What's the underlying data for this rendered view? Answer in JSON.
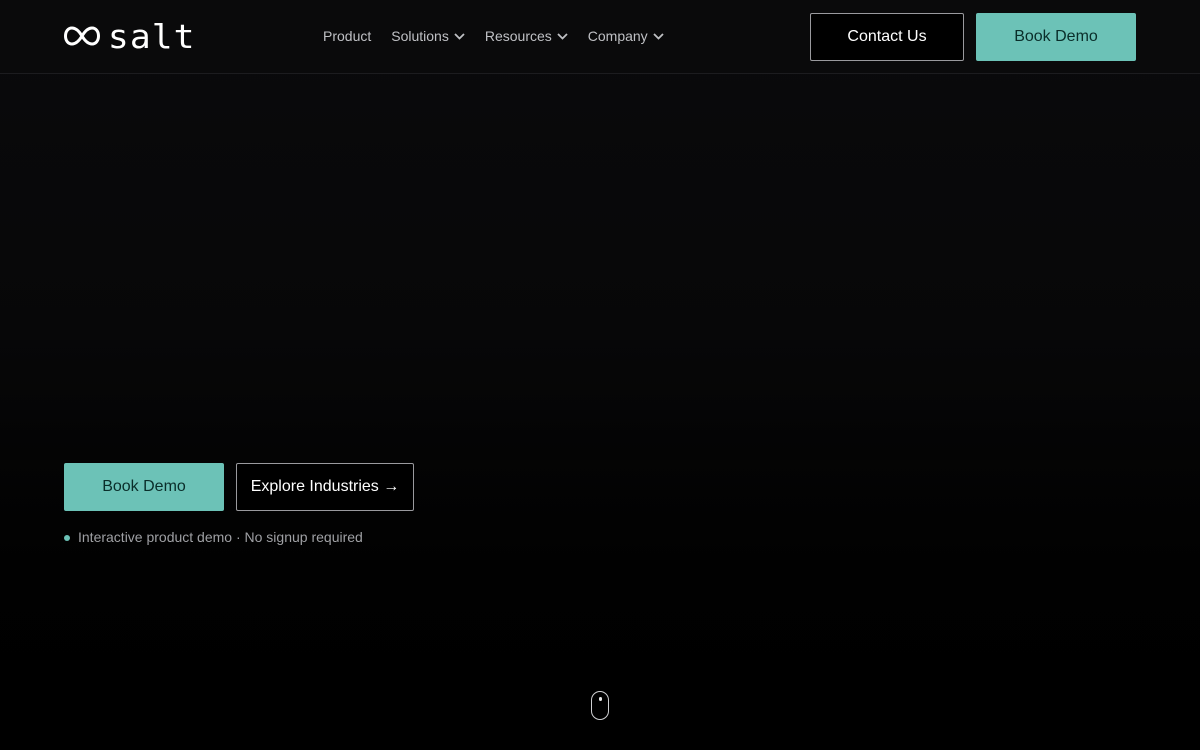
{
  "brand": {
    "name": "salt",
    "icon": "infinity-logo-icon"
  },
  "nav": {
    "items": [
      {
        "label": "Product",
        "has_dropdown": false
      },
      {
        "label": "Solutions",
        "has_dropdown": true
      },
      {
        "label": "Resources",
        "has_dropdown": true
      },
      {
        "label": "Company",
        "has_dropdown": true
      }
    ]
  },
  "header": {
    "contact_label": "Contact Us",
    "demo_label": "Book Demo"
  },
  "hero": {
    "primary_label": "Book Demo",
    "secondary_label": "Explore Industries →",
    "note": "Interactive product demo · No signup required"
  },
  "colors": {
    "accent": "#6cc2b7",
    "background": "#000000",
    "text": "#ffffff",
    "muted": "#9fa0a4"
  },
  "icons": {
    "dropdown": "chevron-down-icon",
    "scroll": "mouse-scroll-icon",
    "status_dot": "dot-icon"
  }
}
